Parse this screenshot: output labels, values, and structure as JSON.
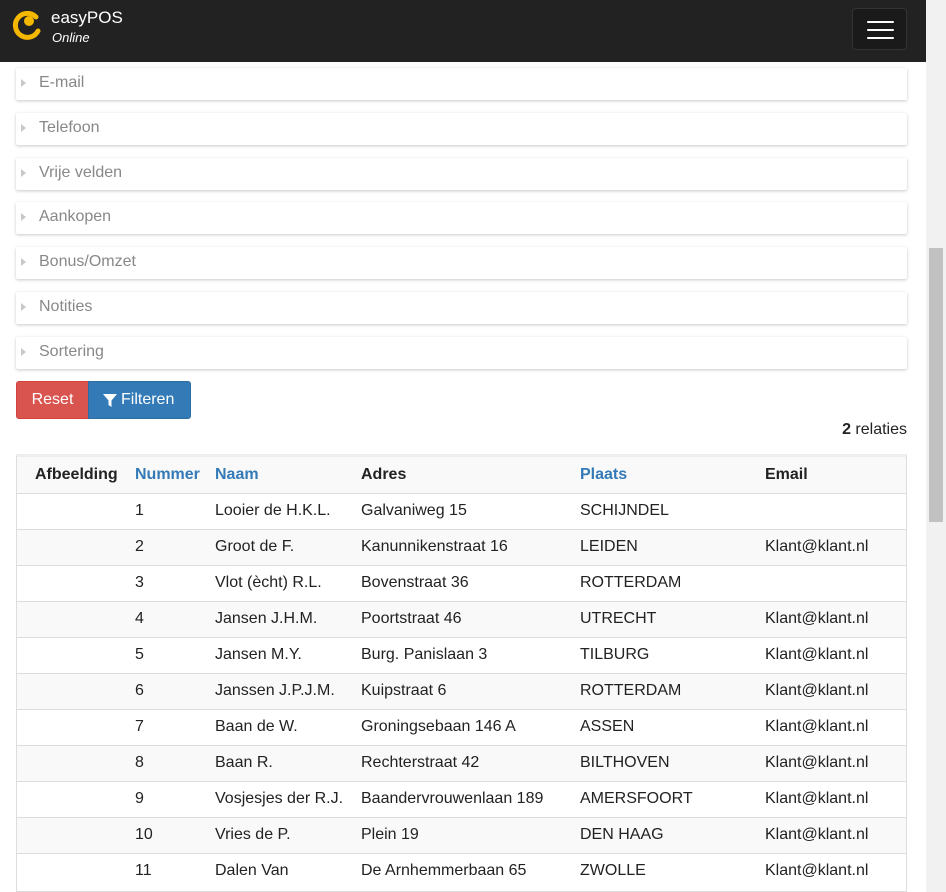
{
  "header": {
    "brand_name": "easyPOS",
    "brand_sub": "Online"
  },
  "filters": [
    {
      "label": "E-mail"
    },
    {
      "label": "Telefoon"
    },
    {
      "label": "Vrije velden"
    },
    {
      "label": "Aankopen"
    },
    {
      "label": "Bonus/Omzet"
    },
    {
      "label": "Notities"
    },
    {
      "label": "Sortering"
    }
  ],
  "buttons": {
    "reset": "Reset",
    "filter": "Filteren"
  },
  "result": {
    "count": "2",
    "unit": "relaties"
  },
  "table": {
    "columns": [
      "Afbeelding",
      "Nummer",
      "Naam",
      "Adres",
      "Plaats",
      "Email"
    ],
    "rows": [
      [
        "",
        "1",
        "Looier de H.K.L.",
        "Galvaniweg 15",
        "SCHIJNDEL",
        ""
      ],
      [
        "",
        "2",
        "Groot de F.",
        "Kanunnikenstraat 16",
        "LEIDEN",
        "Klant@klant.nl"
      ],
      [
        "",
        "3",
        "Vlot (ècht) R.L.",
        "Bovenstraat 36",
        "ROTTERDAM",
        ""
      ],
      [
        "",
        "4",
        "Jansen J.H.M.",
        "Poortstraat 46",
        "UTRECHT",
        "Klant@klant.nl"
      ],
      [
        "",
        "5",
        "Jansen M.Y.",
        "Burg. Panislaan 3",
        "TILBURG",
        "Klant@klant.nl"
      ],
      [
        "",
        "6",
        "Janssen J.P.J.M.",
        "Kuipstraat 6",
        "ROTTERDAM",
        "Klant@klant.nl"
      ],
      [
        "",
        "7",
        "Baan de W.",
        "Groningsebaan 146 A",
        "ASSEN",
        "Klant@klant.nl"
      ],
      [
        "",
        "8",
        "Baan R.",
        "Rechterstraat 42",
        "BILTHOVEN",
        "Klant@klant.nl"
      ],
      [
        "",
        "9",
        "Vosjesjes der R.J.",
        "Baandervrouwenlaan 189",
        "AMERSFOORT",
        "Klant@klant.nl"
      ],
      [
        "",
        "10",
        "Vries de P.",
        "Plein 19",
        "DEN HAAG",
        "Klant@klant.nl"
      ],
      [
        "",
        "11",
        "Dalen Van",
        "De Arnhemmerbaan 65",
        "ZWOLLE",
        "Klant@klant.nl"
      ]
    ]
  },
  "colors": {
    "navbar": "#222222",
    "logo": "#f5b800",
    "danger": "#d9534f",
    "primary": "#337ab7"
  },
  "icons": {
    "logo": "easypos-logo-icon",
    "menu": "hamburger-icon",
    "panel": "caret-right-icon",
    "filter": "filter-icon"
  }
}
